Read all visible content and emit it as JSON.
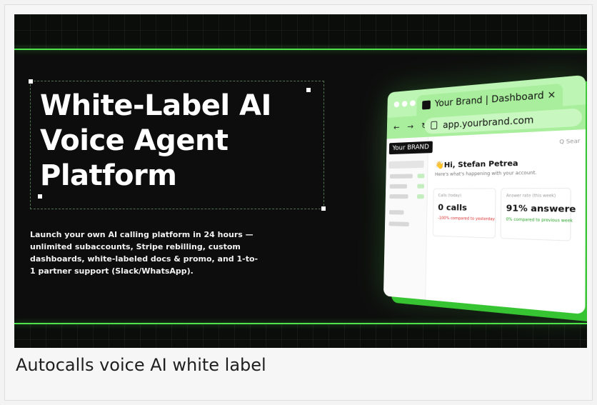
{
  "hero": {
    "title": "White-Label AI\nVoice Agent\nPlatform",
    "description": "Launch your own AI calling platform in 24 hours — unlimited subaccounts, Stripe rebilling, custom dashboards, white-labeled docs & promo, and 1-to-1 partner support (Slack/WhatsApp).",
    "accent_color": "#4ee34a",
    "background_color": "#0d0d0d"
  },
  "browser": {
    "tab_title": "Your Brand | Dashboard",
    "tab_close": "×",
    "nav_icons": "← → ↻",
    "url": "app.yourbrand.com",
    "brand_badge": "Your BRAND",
    "search_stub": "Q Sear",
    "greeting": "👋Hi, Stefan Petrea",
    "greeting_sub": "Here's what's happening with your account.",
    "stats": [
      {
        "label": "Calls (today)",
        "value": "0 calls",
        "note": "-100% compared to yesterday"
      },
      {
        "label": "Answer rate (this week)",
        "value": "91% answere",
        "note": "0% compared to previous week"
      }
    ]
  },
  "caption": "Autocalls voice AI white label"
}
